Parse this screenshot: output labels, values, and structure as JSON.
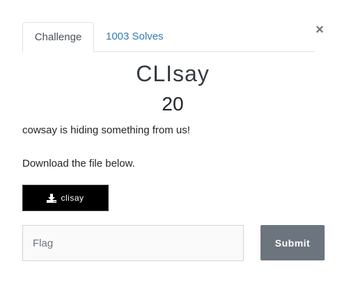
{
  "modal": {
    "close_symbol": "×"
  },
  "tabs": [
    {
      "label": "Challenge",
      "active": true
    },
    {
      "label": "1003 Solves",
      "active": false
    }
  ],
  "challenge": {
    "name": "CLIsay",
    "points": "20",
    "description_line1": "cowsay is hiding something from us!",
    "description_line2": "Download the file below."
  },
  "download": {
    "label": "clisay",
    "icon": "download-icon"
  },
  "flag": {
    "placeholder": "Flag",
    "value": ""
  },
  "submit": {
    "label": "Submit"
  },
  "colors": {
    "link": "#337ab7",
    "submit_bg": "#6c757d",
    "download_bg": "#000000"
  }
}
